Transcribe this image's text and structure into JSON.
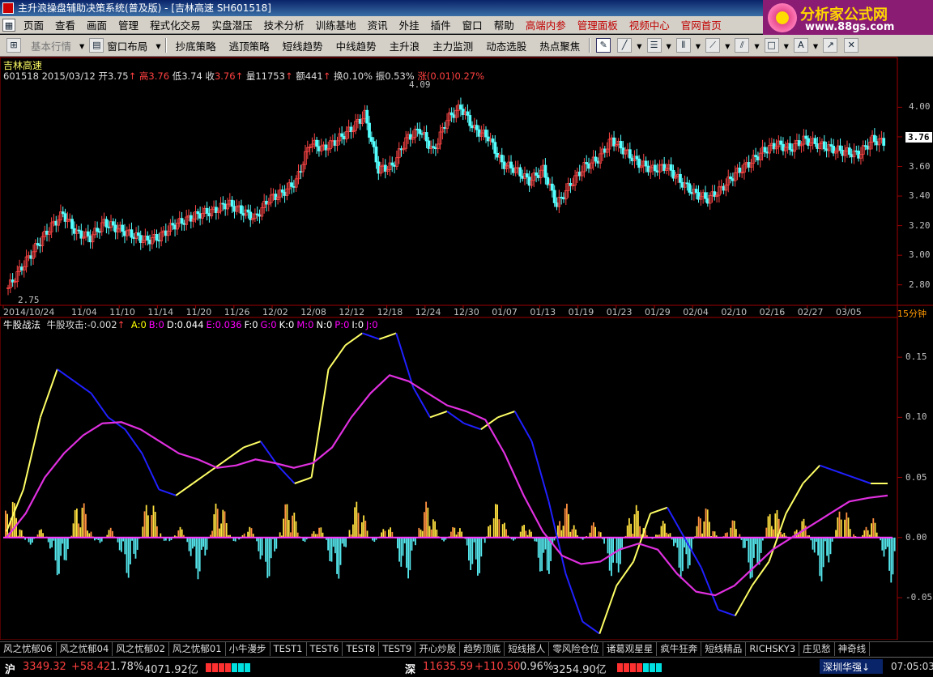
{
  "window": {
    "title": "主升浪操盘辅助决策系统(普及版) - [吉林高速 SH601518]"
  },
  "logo": {
    "line1": "分析家公式网",
    "line2": "www.88gs.com"
  },
  "menu": [
    "页面",
    "查看",
    "画面",
    "管理",
    "程式化交易",
    "实盘潜压",
    "技术分析",
    "训练基地",
    "资讯",
    "外挂",
    "插件",
    "窗口",
    "帮助",
    "高端内参",
    "管理面板",
    "视频中心",
    "官网首页"
  ],
  "toolbar": {
    "market_label": "基本行情",
    "layout_label": "窗口布局",
    "strategies": [
      "抄底策略",
      "逃顶策略",
      "短线趋势",
      "中线趋势",
      "主升浪",
      "主力监测",
      "动态选股",
      "热点聚焦"
    ]
  },
  "stock": {
    "name": "吉林高速",
    "code": "601518",
    "date": "2015/03/12",
    "open_label": "开",
    "open": "3.75",
    "high_label": "高",
    "high": "3.76",
    "low_label": "低",
    "low": "3.74",
    "close_label": "收",
    "close": "3.76",
    "vol_label": "量",
    "vol": "11753",
    "amt_label": "额",
    "amt": "441",
    "turn_label": "换",
    "turn": "0.10%",
    "amp_label": "振",
    "amp": "0.53%",
    "chg_label": "涨",
    "chg": "(0.01)",
    "chg_pct": "0.27%",
    "max_mark": "4.09",
    "min_mark": "2.75",
    "last_price": "3.76"
  },
  "price_axis": [
    "4.00",
    "3.80",
    "3.60",
    "3.40",
    "3.20",
    "3.00",
    "2.80"
  ],
  "dates": [
    "2014/10/24",
    "11/04",
    "11/10",
    "11/14",
    "11/20",
    "11/26",
    "12/02",
    "12/08",
    "12/12",
    "12/18",
    "12/24",
    "12/30",
    "01/07",
    "01/13",
    "01/19",
    "01/23",
    "01/29",
    "02/04",
    "02/10",
    "02/16",
    "02/27",
    "03/05"
  ],
  "period": "15分钟",
  "indicator": {
    "name": "牛股战法",
    "series_label": "牛股攻击:",
    "series_value": "-0.002",
    "vars": [
      {
        "k": "A:",
        "v": "0",
        "c": "#ffff00"
      },
      {
        "k": "B:",
        "v": "0",
        "c": "#ff00ff"
      },
      {
        "k": "D:",
        "v": "0.044",
        "c": "#ffffff"
      },
      {
        "k": "E:",
        "v": "0.036",
        "c": "#ff00ff"
      },
      {
        "k": "F:",
        "v": "0",
        "c": "#ffffff"
      },
      {
        "k": "G:",
        "v": "0",
        "c": "#ff00ff"
      },
      {
        "k": "K:",
        "v": "0",
        "c": "#ffffff"
      },
      {
        "k": "M:",
        "v": "0",
        "c": "#ff00ff"
      },
      {
        "k": "N:",
        "v": "0",
        "c": "#ffffff"
      },
      {
        "k": "P:",
        "v": "0",
        "c": "#ff00ff"
      },
      {
        "k": "I:",
        "v": "0",
        "c": "#ffffff"
      },
      {
        "k": "J:",
        "v": "0",
        "c": "#ff00ff"
      }
    ],
    "axis": [
      "0.15",
      "0.10",
      "0.05",
      "0.00",
      "-0.05"
    ]
  },
  "tabs": [
    "风之忧郁06",
    "风之忧郁04",
    "风之忧郁02",
    "风之忧郁01",
    "小牛漫步",
    "TEST1",
    "TEST6",
    "TEST8",
    "TEST9",
    "开心炒股",
    "趋势顶底",
    "短线搭人",
    "零风险仓位",
    "诸葛观星星",
    "疯牛狂奔",
    "短线精品",
    "RICHSKY3",
    "庄见愁",
    "神奇线"
  ],
  "status": {
    "sh_label": "沪",
    "sh_index": "3349.32",
    "sh_chg": "+58.42",
    "sh_pct": "1.78%",
    "sh_amt": "4071.92亿",
    "sz_label": "深",
    "sz_index": "11635.59",
    "sz_chg": "+110.50",
    "sz_pct": "0.96%",
    "sz_amt": "3254.90亿",
    "ticker": "深圳华强↓",
    "time": "07:05:03"
  },
  "chart_data": [
    {
      "type": "candlestick",
      "title": "吉林高速",
      "ylim": [
        2.7,
        4.15
      ],
      "y_ticks": [
        2.8,
        3.0,
        3.2,
        3.4,
        3.6,
        3.8,
        4.0
      ],
      "x_tick_labels": [
        "2014/10/24",
        "11/04",
        "11/10",
        "11/14",
        "11/20",
        "11/26",
        "12/02",
        "12/08",
        "12/12",
        "12/18",
        "12/24",
        "12/30",
        "01/07",
        "01/13",
        "01/19",
        "01/23",
        "01/29",
        "02/04",
        "02/10",
        "02/16",
        "02/27",
        "03/05"
      ],
      "series": [
        {
          "name": "收",
          "values": [
            2.78,
            2.92,
            3.05,
            3.18,
            3.28,
            3.15,
            3.12,
            3.22,
            3.18,
            3.14,
            3.1,
            3.12,
            3.2,
            3.24,
            3.28,
            3.3,
            3.35,
            3.3,
            3.25,
            3.38,
            3.42,
            3.5,
            3.76,
            3.72,
            3.78,
            3.85,
            3.95,
            3.58,
            3.6,
            3.78,
            3.85,
            3.7,
            3.92,
            4.0,
            3.85,
            3.8,
            3.62,
            3.58,
            3.5,
            3.58,
            3.34,
            3.48,
            3.6,
            3.65,
            3.78,
            3.7,
            3.62,
            3.58,
            3.6,
            3.5,
            3.42,
            3.38,
            3.45,
            3.55,
            3.62,
            3.7,
            3.75,
            3.72,
            3.78,
            3.75,
            3.72,
            3.7,
            3.68,
            3.78,
            3.76
          ]
        }
      ],
      "annotations": [
        "4.09",
        "2.75"
      ]
    },
    {
      "type": "line",
      "title": "牛股战法",
      "ylim": [
        -0.085,
        0.175
      ],
      "y_ticks": [
        -0.05,
        0.0,
        0.05,
        0.1,
        0.15
      ],
      "series": [
        {
          "name": "牛股攻击",
          "values": [
            0.005,
            0.04,
            0.1,
            0.14,
            0.13,
            0.12,
            0.1,
            0.09,
            0.07,
            0.04,
            0.035,
            0.045,
            0.055,
            0.065,
            0.075,
            0.08,
            0.06,
            0.045,
            0.05,
            0.14,
            0.16,
            0.17,
            0.165,
            0.17,
            0.125,
            0.1,
            0.105,
            0.095,
            0.09,
            0.1,
            0.105,
            0.08,
            0.03,
            -0.03,
            -0.07,
            -0.08,
            -0.04,
            -0.02,
            0.02,
            0.025,
            0.0,
            -0.025,
            -0.06,
            -0.065,
            -0.04,
            -0.02,
            0.02,
            0.045,
            0.06,
            0.055,
            0.05,
            0.045,
            0.045
          ]
        },
        {
          "name": "均线",
          "values": [
            0.0,
            0.02,
            0.05,
            0.07,
            0.085,
            0.095,
            0.096,
            0.09,
            0.08,
            0.07,
            0.065,
            0.058,
            0.06,
            0.065,
            0.062,
            0.058,
            0.062,
            0.075,
            0.1,
            0.12,
            0.135,
            0.13,
            0.12,
            0.11,
            0.105,
            0.098,
            0.07,
            0.035,
            0.005,
            -0.015,
            -0.022,
            -0.02,
            -0.01,
            -0.005,
            -0.01,
            -0.03,
            -0.045,
            -0.048,
            -0.04,
            -0.025,
            -0.01,
            0.0,
            0.01,
            0.02,
            0.03,
            0.033,
            0.035
          ]
        }
      ]
    }
  ]
}
